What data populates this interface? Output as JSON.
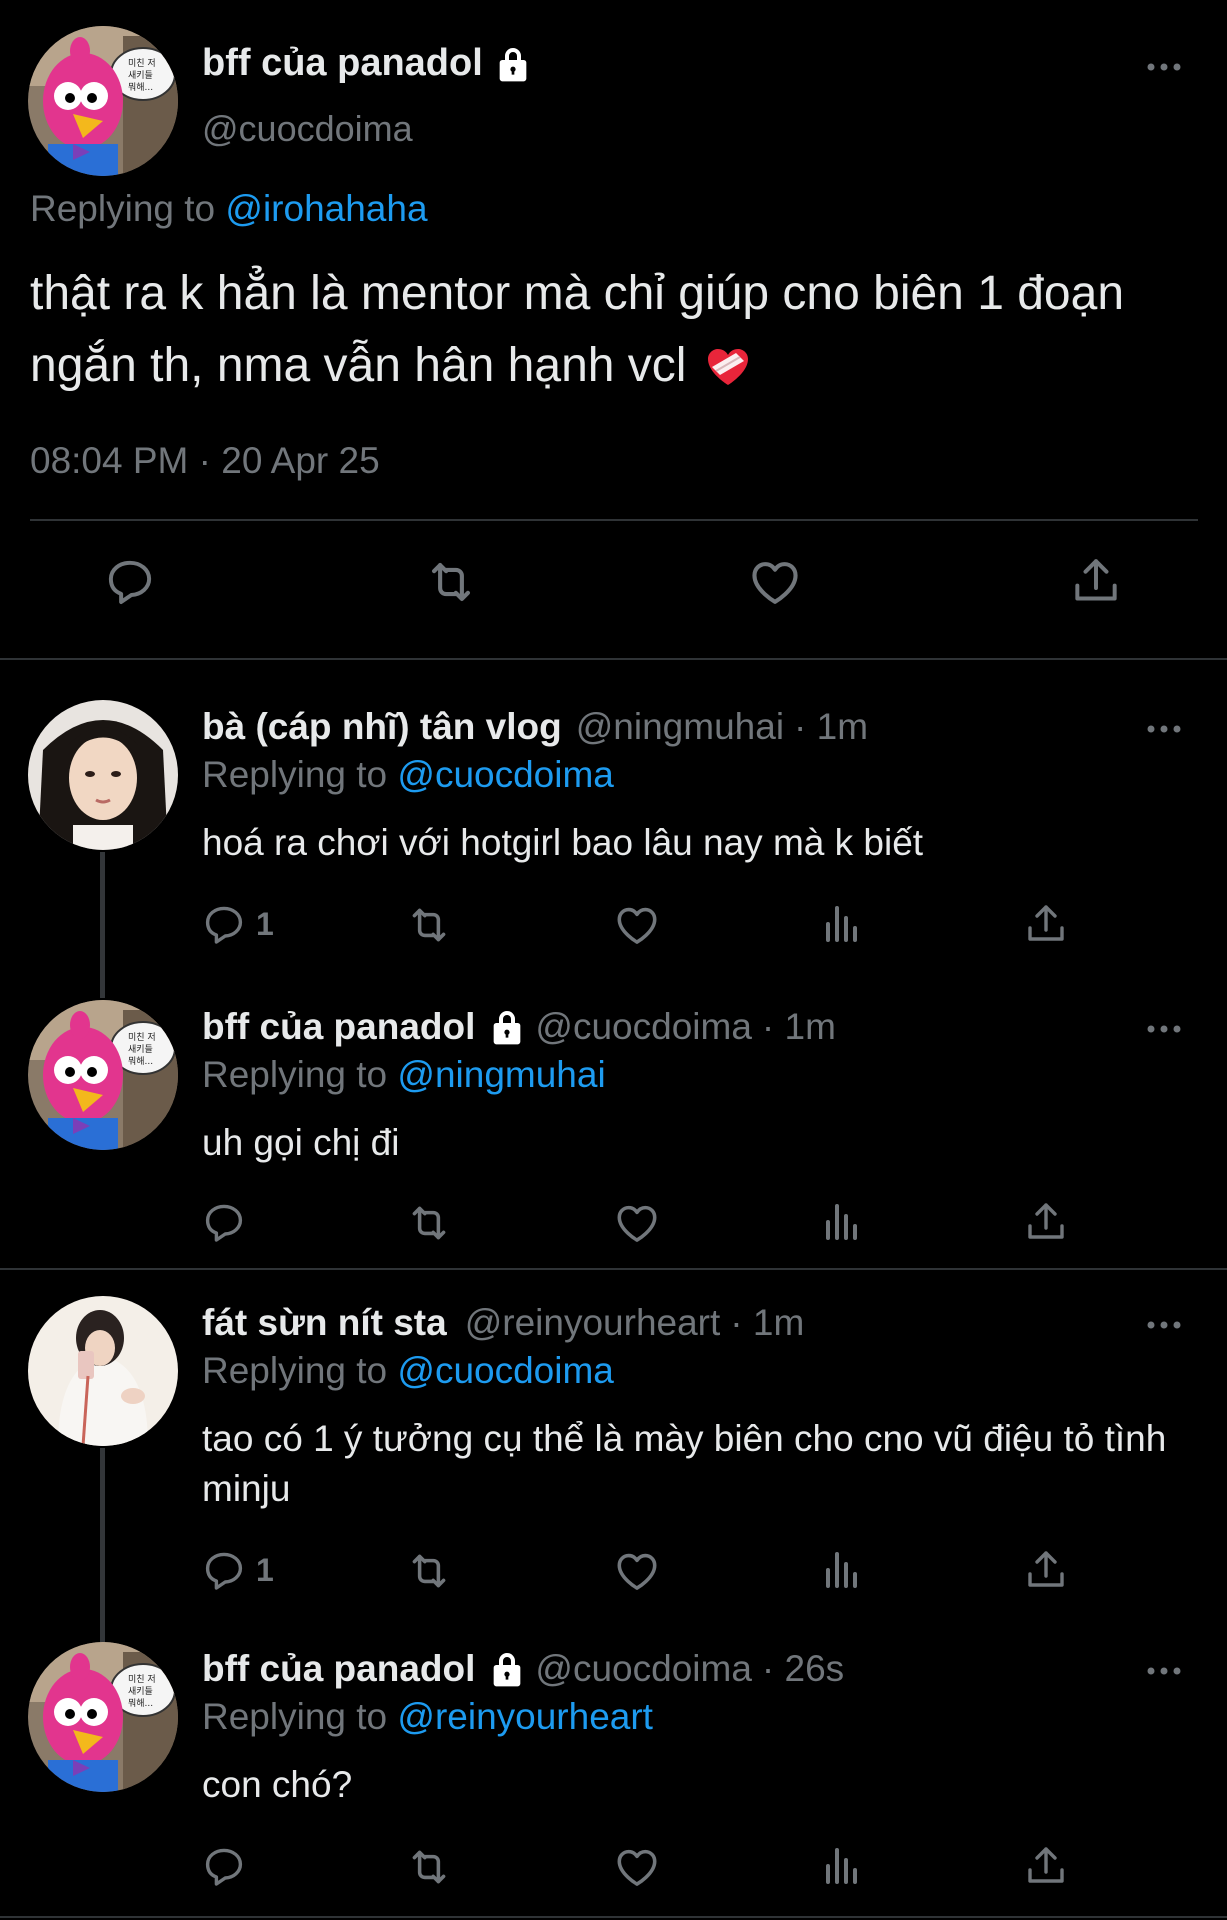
{
  "main_tweet": {
    "author_name": "bff của panadol",
    "author_handle": "@cuocdoima",
    "replying_prefix": "Replying to",
    "replying_to": "@irohahaha",
    "text": "thật ra k hẳn là mentor mà chỉ giúp cno biên 1 đoạn ngắn th, nma vẫn hân hạnh vcl",
    "emoji": "heart-with-bandage-icon",
    "timestamp": "08:04 PM · 20 Apr 25",
    "avatar_speech_text": "미친 저 새키들 뭐해..."
  },
  "replies": [
    {
      "author_name": "bà (cáp nhĩ) tân vlog",
      "author_handle": "@ningmuhai",
      "time": "· 1m",
      "locked": false,
      "replying_prefix": "Replying to",
      "replying_to": "@cuocdoima",
      "text": "hoá ra chơi với hotgirl bao lâu nay mà k biết",
      "reply_count": "1"
    },
    {
      "author_name": "bff của panadol",
      "author_handle": "@cuocdoima",
      "time": "· 1m",
      "locked": true,
      "replying_prefix": "Replying to",
      "replying_to": "@ningmuhai",
      "text": "uh gọi chị đi",
      "reply_count": ""
    },
    {
      "author_name": "fát sừn nít sta",
      "author_handle": "@reinyourheart",
      "time": "· 1m",
      "locked": false,
      "replying_prefix": "Replying to",
      "replying_to": "@cuocdoima",
      "text": "tao có 1 ý tưởng cụ thể là mày biên cho cno vũ điệu tỏ tình minju",
      "reply_count": "1"
    },
    {
      "author_name": "bff của panadol",
      "author_handle": "@cuocdoima",
      "time": "· 26s",
      "locked": true,
      "replying_prefix": "Replying to",
      "replying_to": "@reinyourheart",
      "text": "con chó?",
      "reply_count": ""
    }
  ],
  "icons": {
    "reply": "reply-icon",
    "retweet": "retweet-icon",
    "like": "like-icon",
    "views": "views-icon",
    "share": "share-icon",
    "more": "more-icon",
    "lock": "lock-icon"
  },
  "colors": {
    "background": "#000000",
    "text": "#e7e9ea",
    "secondary": "#71767b",
    "link": "#1d9bf0",
    "divider": "#2f3336"
  }
}
